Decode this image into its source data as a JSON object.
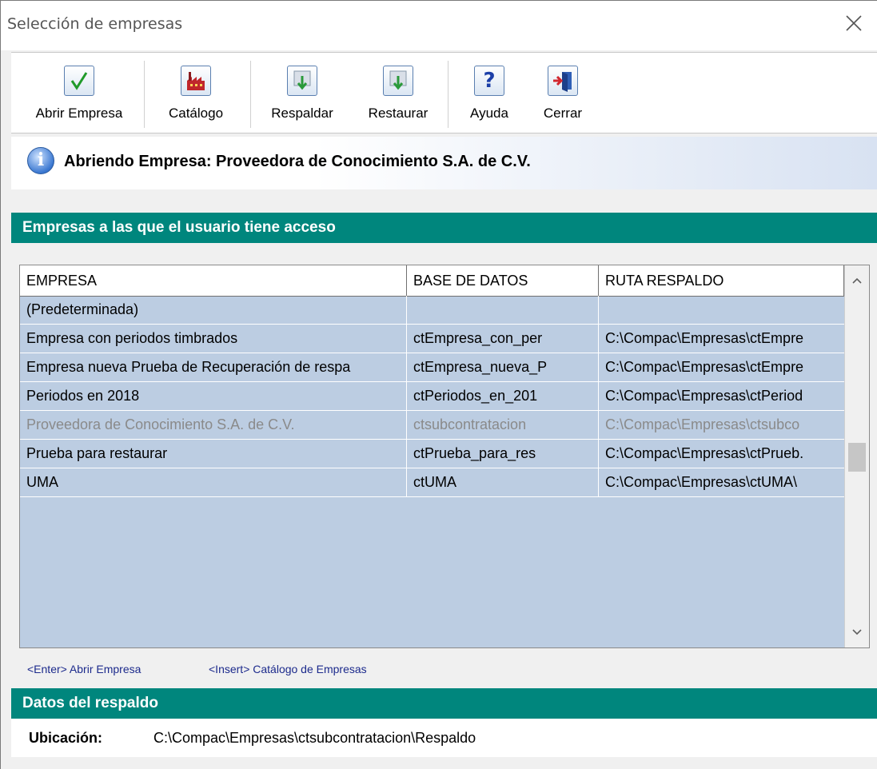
{
  "window": {
    "title": "Selección de empresas"
  },
  "toolbar": {
    "buttons": [
      {
        "label": "Abrir Empresa",
        "icon": "check-icon"
      },
      {
        "label": "Catálogo",
        "icon": "factory-icon"
      },
      {
        "label": "Respaldar",
        "icon": "backup-icon"
      },
      {
        "label": "Restaurar",
        "icon": "restore-icon"
      },
      {
        "label": "Ayuda",
        "icon": "help-icon"
      },
      {
        "label": "Cerrar",
        "icon": "exit-icon"
      }
    ]
  },
  "status": {
    "message": "Abriendo Empresa: Proveedora de Conocimiento S.A. de C.V."
  },
  "companies_section": {
    "title": "Empresas a las que el usuario tiene acceso",
    "columns": [
      "EMPRESA",
      "BASE DE DATOS",
      "RUTA RESPALDO"
    ],
    "rows": [
      [
        "(Predeterminada)",
        "",
        ""
      ],
      [
        "Empresa con periodos timbrados",
        "ctEmpresa_con_per",
        "C:\\Compac\\Empresas\\ctEmpre"
      ],
      [
        "Empresa nueva Prueba de Recuperación de respa",
        "ctEmpresa_nueva_P",
        "C:\\Compac\\Empresas\\ctEmpre"
      ],
      [
        "Periodos en 2018",
        "ctPeriodos_en_201",
        "C:\\Compac\\Empresas\\ctPeriod"
      ],
      [
        "Proveedora de Conocimiento S.A. de C.V.",
        "ctsubcontratacion",
        "C:\\Compac\\Empresas\\ctsubco"
      ],
      [
        "Prueba para restaurar",
        "ctPrueba_para_res",
        "C:\\Compac\\Empresas\\ctPrueb."
      ],
      [
        "UMA",
        "ctUMA",
        "C:\\Compac\\Empresas\\ctUMA\\"
      ]
    ],
    "selected_row": 4
  },
  "hints": {
    "enter": "<Enter> Abrir Empresa",
    "insert": "<Insert> Catálogo de Empresas"
  },
  "backup_section": {
    "title": "Datos del respaldo",
    "location_label": "Ubicación:",
    "location_value": "C:\\Compac\\Empresas\\ctsubcontratacion\\Respaldo"
  },
  "colors": {
    "section_header": "#00867d",
    "grid_background": "#bccde2"
  }
}
